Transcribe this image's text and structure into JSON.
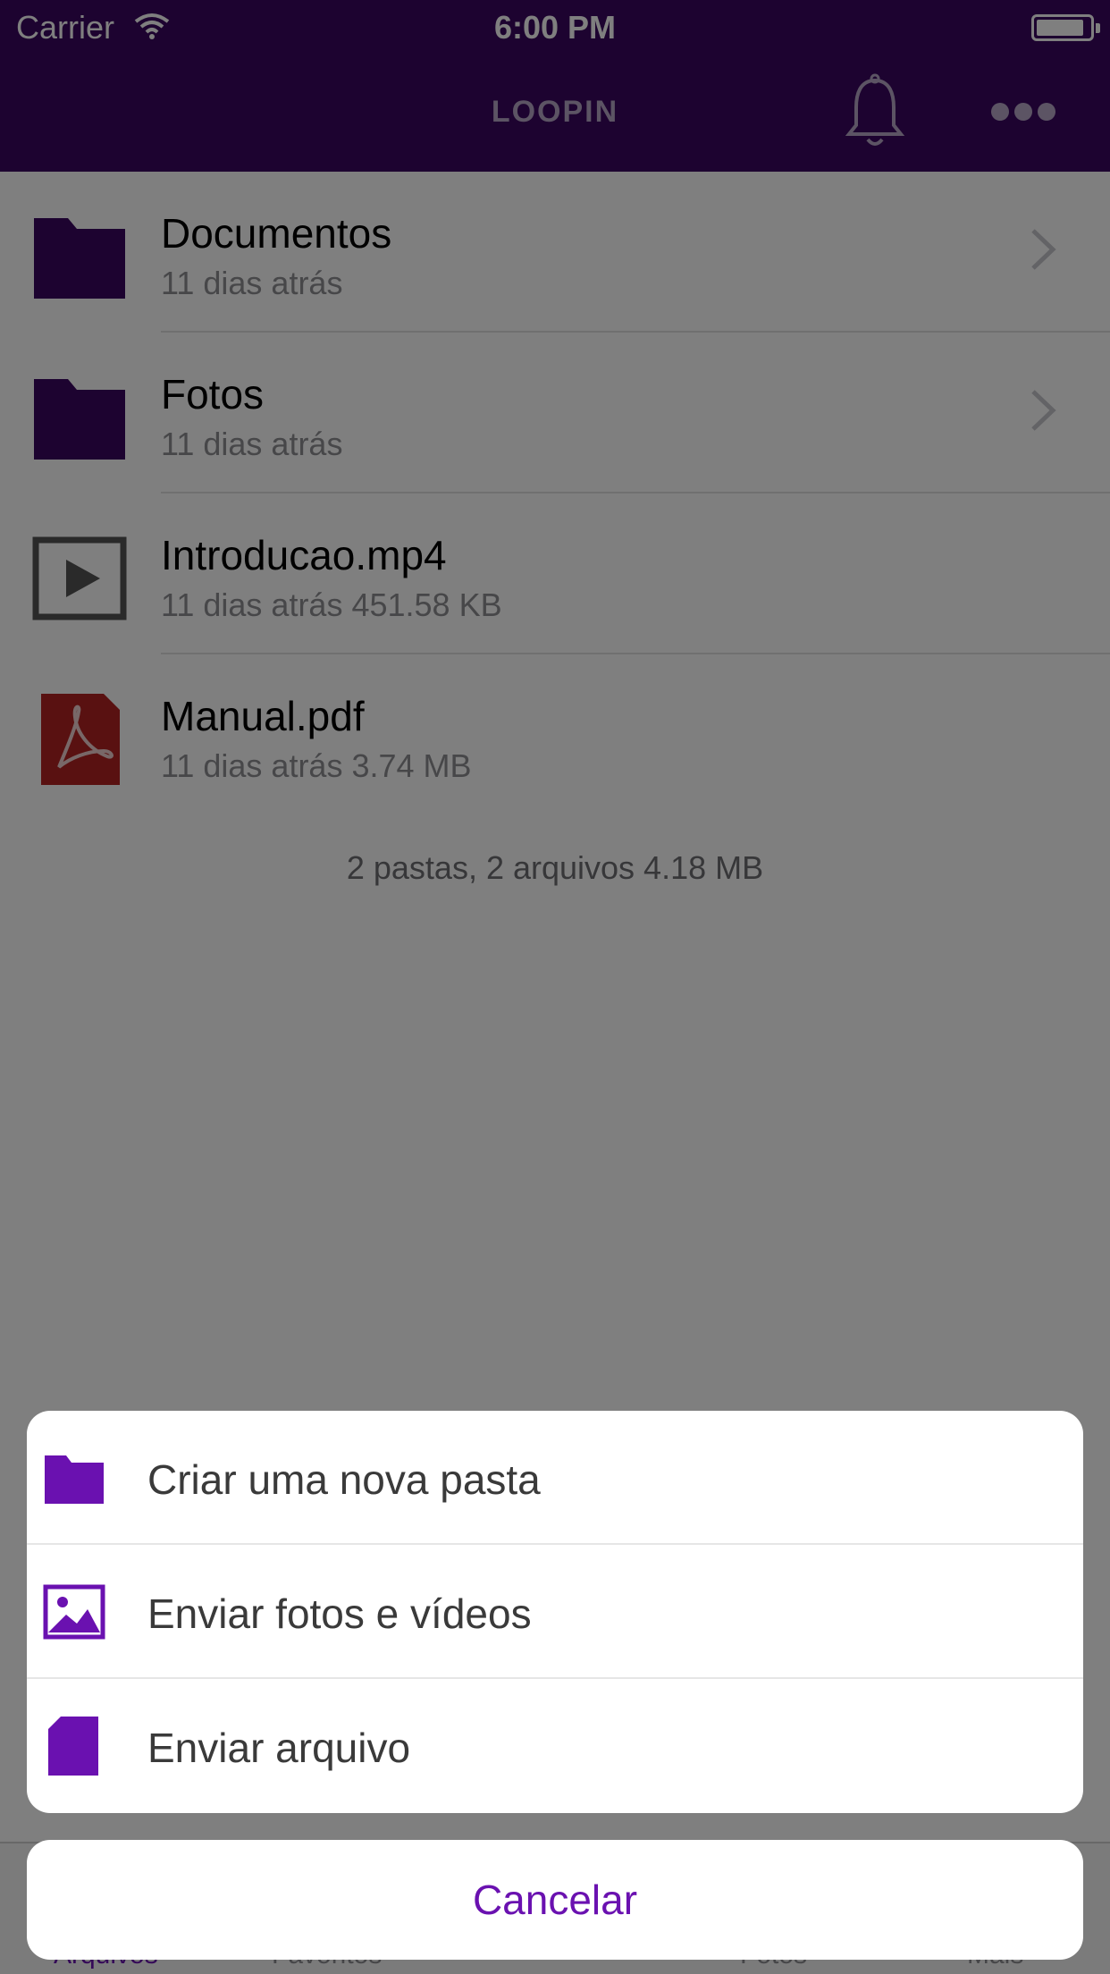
{
  "status_bar": {
    "carrier": "Carrier",
    "time": "6:00 PM",
    "battery_level": 0.8
  },
  "nav_bar": {
    "title": "LOOPIN",
    "bell_icon": "bell-icon",
    "more_icon": "more-dots-icon"
  },
  "files": [
    {
      "name": "Documentos",
      "subtitle": "11 dias atrás",
      "icon": "folder-icon"
    },
    {
      "name": "Fotos",
      "subtitle": "11 dias atrás",
      "icon": "folder-icon"
    },
    {
      "name": "Introducao.mp4",
      "subtitle": "11 dias atrás 451.58 KB",
      "icon": "video-icon"
    },
    {
      "name": "Manual.pdf",
      "subtitle": "11 dias atrás 3.74 MB",
      "icon": "pdf-icon"
    }
  ],
  "summary": "2 pastas, 2 arquivos 4.18 MB",
  "tabs": [
    {
      "label": "Arquivos"
    },
    {
      "label": "Favoritos"
    },
    {
      "label": "Fotos"
    },
    {
      "label": "Mais"
    }
  ],
  "action_sheet": {
    "items": [
      {
        "label": "Criar uma nova pasta",
        "icon": "folder-icon"
      },
      {
        "label": "Enviar fotos e vídeos",
        "icon": "image-icon"
      },
      {
        "label": "Enviar arquivo",
        "icon": "file-icon"
      }
    ],
    "cancel_label": "Cancelar"
  },
  "colors": {
    "brand": "#3a0660",
    "accent": "#6a11b0",
    "folder": "#3a0660",
    "pdf": "#b22222"
  }
}
